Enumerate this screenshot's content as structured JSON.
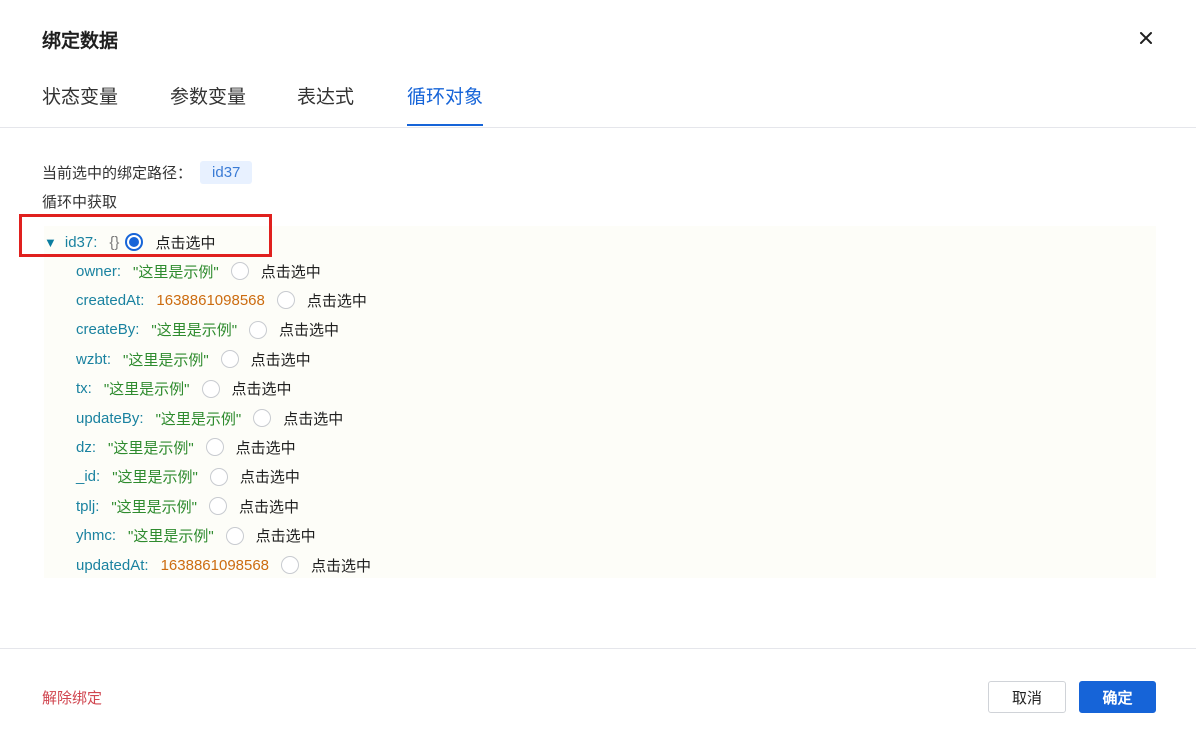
{
  "dialog": {
    "title": "绑定数据"
  },
  "tabs": [
    {
      "label": "状态变量"
    },
    {
      "label": "参数变量"
    },
    {
      "label": "表达式"
    },
    {
      "label": "循环对象"
    }
  ],
  "path": {
    "label": "当前选中的绑定路径：",
    "value": "id37"
  },
  "section_label": "循环中获取",
  "tree": {
    "root": {
      "key": "id37",
      "colon": ":",
      "type_hint": "{}",
      "pick_label": "点击选中",
      "selected": true
    },
    "children": [
      {
        "key": "owner",
        "value": "\"这里是示例\"",
        "kind": "string",
        "pick_label": "点击选中"
      },
      {
        "key": "createdAt",
        "value": "1638861098568",
        "kind": "number",
        "pick_label": "点击选中"
      },
      {
        "key": "createBy",
        "value": "\"这里是示例\"",
        "kind": "string",
        "pick_label": "点击选中"
      },
      {
        "key": "wzbt",
        "value": "\"这里是示例\"",
        "kind": "string",
        "pick_label": "点击选中"
      },
      {
        "key": "tx",
        "value": "\"这里是示例\"",
        "kind": "string",
        "pick_label": "点击选中"
      },
      {
        "key": "updateBy",
        "value": "\"这里是示例\"",
        "kind": "string",
        "pick_label": "点击选中"
      },
      {
        "key": "dz",
        "value": "\"这里是示例\"",
        "kind": "string",
        "pick_label": "点击选中"
      },
      {
        "key": "_id",
        "value": "\"这里是示例\"",
        "kind": "string",
        "pick_label": "点击选中"
      },
      {
        "key": "tplj",
        "value": "\"这里是示例\"",
        "kind": "string",
        "pick_label": "点击选中"
      },
      {
        "key": "yhmc",
        "value": "\"这里是示例\"",
        "kind": "string",
        "pick_label": "点击选中"
      },
      {
        "key": "updatedAt",
        "value": "1638861098568",
        "kind": "number",
        "pick_label": "点击选中"
      }
    ]
  },
  "footer": {
    "unbind_label": "解除绑定",
    "cancel_label": "取消",
    "ok_label": "确定"
  },
  "colors": {
    "accent": "#1664d8",
    "danger": "#d0454f",
    "highlight_box": "#e0201e",
    "string_value": "#2e8b2e",
    "number_value": "#cc6c10"
  }
}
